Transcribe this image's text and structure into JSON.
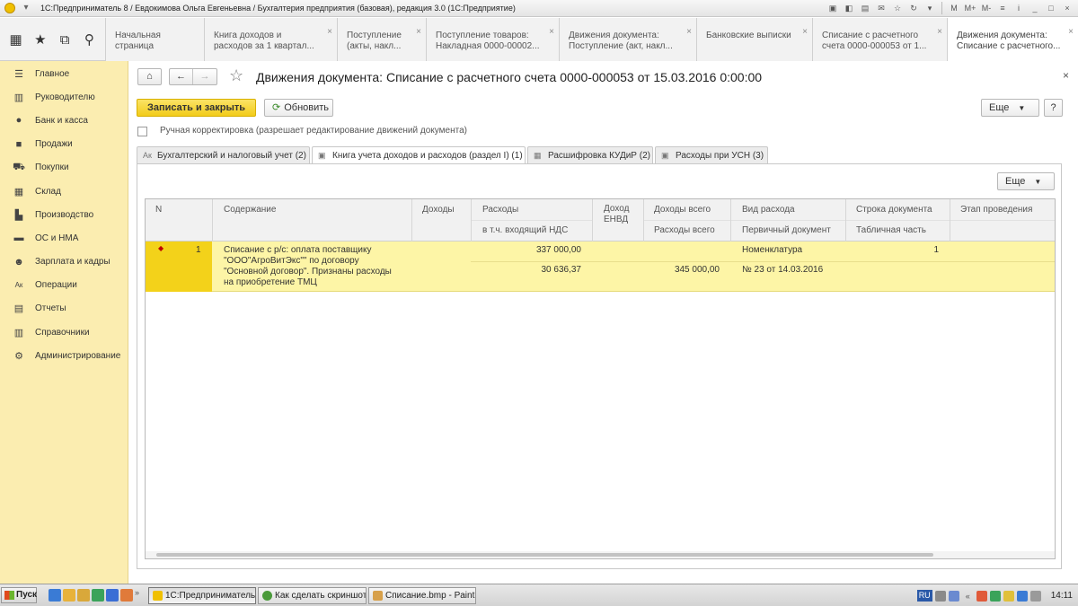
{
  "window": {
    "title": "1С:Предприниматель 8 / Евдокимова Ольга Евгеньевна / Бухгалтерия предприятия (базовая), редакция 3.0  (1С:Предприятие)",
    "controls": [
      "M",
      "M+",
      "M-",
      "≡",
      "i",
      "_",
      "□",
      "×"
    ]
  },
  "tabs": [
    {
      "label": "Начальная страница",
      "closable": false
    },
    {
      "label": "Книга доходов и\nрасходов за 1 квартал...",
      "closable": true
    },
    {
      "label": "Поступление\n(акты, накл...",
      "closable": true
    },
    {
      "label": "Поступление товаров:\nНакладная 0000-00002...",
      "closable": true
    },
    {
      "label": "Движения документа:\nПоступление (акт, накл...",
      "closable": true
    },
    {
      "label": "Банковские выписки",
      "closable": true
    },
    {
      "label": "Списание с расчетного\nсчета 0000-000053 от 1...",
      "closable": true
    },
    {
      "label": "Движения документа:\nСписание с расчетного...",
      "closable": true
    }
  ],
  "sidebar": {
    "items": [
      {
        "label": "Главное",
        "icon": "menu-icon",
        "glyph": "☰"
      },
      {
        "label": "Руководителю",
        "icon": "chart-icon",
        "glyph": "▥"
      },
      {
        "label": "Банк и касса",
        "icon": "ruble-icon",
        "glyph": "●"
      },
      {
        "label": "Продажи",
        "icon": "bag-icon",
        "glyph": "■"
      },
      {
        "label": "Покупки",
        "icon": "cart-icon",
        "glyph": "⛟"
      },
      {
        "label": "Склад",
        "icon": "warehouse-icon",
        "glyph": "▦"
      },
      {
        "label": "Производство",
        "icon": "factory-icon",
        "glyph": "▙"
      },
      {
        "label": "ОС и НМА",
        "icon": "assets-icon",
        "glyph": "▬"
      },
      {
        "label": "Зарплата и кадры",
        "icon": "people-icon",
        "glyph": "☻"
      },
      {
        "label": "Операции",
        "icon": "operations-icon",
        "glyph": "Ак"
      },
      {
        "label": "Отчеты",
        "icon": "reports-icon",
        "glyph": "▤"
      },
      {
        "label": "Справочники",
        "icon": "books-icon",
        "glyph": "▥"
      },
      {
        "label": "Администрирование",
        "icon": "gear-icon",
        "glyph": "⚙"
      }
    ]
  },
  "document": {
    "title": "Движения документа: Списание с расчетного счета 0000-000053 от 15.03.2016 0:00:00",
    "save_close": "Записать и закрыть",
    "refresh": "Обновить",
    "more": "Еще",
    "help": "?",
    "manual_edit_label": "Ручная корректировка (разрешает редактирование движений документа)",
    "manual_edit_checked": false
  },
  "form_tabs": [
    {
      "label": "Бухгалтерский и налоговый учет (2)",
      "icon": "ledger-icon",
      "active": false
    },
    {
      "label": "Книга учета доходов и расходов (раздел I) (1)",
      "icon": "register-icon",
      "active": true
    },
    {
      "label": "Расшифровка КУДиР (2)",
      "icon": "table-icon",
      "active": false
    },
    {
      "label": "Расходы при УСН (3)",
      "icon": "register-icon",
      "active": false
    }
  ],
  "table": {
    "more": "Еще",
    "headers": {
      "n": "N",
      "content": "Содержание",
      "income": "Доходы",
      "expenses": "Расходы",
      "vat_incl": "в т.ч. входящий НДС",
      "envd_income": "Доход\nЕНВД",
      "total_income": "Доходы всего",
      "total_expenses": "Расходы всего",
      "expense_type": "Вид расхода",
      "primary_doc": "Первичный документ",
      "doc_line": "Строка документа",
      "tabular_part": "Табличная часть",
      "stage": "Этап проведения"
    },
    "rows": [
      {
        "n": "1",
        "content": "Списание с р/с: оплата поставщику\n\"ООО\"АгроВитЭкс\"\" по договору\n\"Основной договор\". Признаны расходы\nна приобретение ТМЦ",
        "expenses": "337 000,00",
        "vat_incl": "30 636,37",
        "total_expenses": "345 000,00",
        "expense_type": "Номенклатура",
        "primary_doc": "№ 23 от 14.03.2016",
        "doc_line": "1"
      }
    ]
  },
  "taskbar": {
    "start": "Пуск",
    "tasks": [
      {
        "label": "1С:Предприниматель ...",
        "active": true
      },
      {
        "label": "Как сделать скриншот ...",
        "active": false
      },
      {
        "label": "Списание.bmp - Paint",
        "active": false
      }
    ],
    "lang": "RU",
    "time": "14:11"
  }
}
